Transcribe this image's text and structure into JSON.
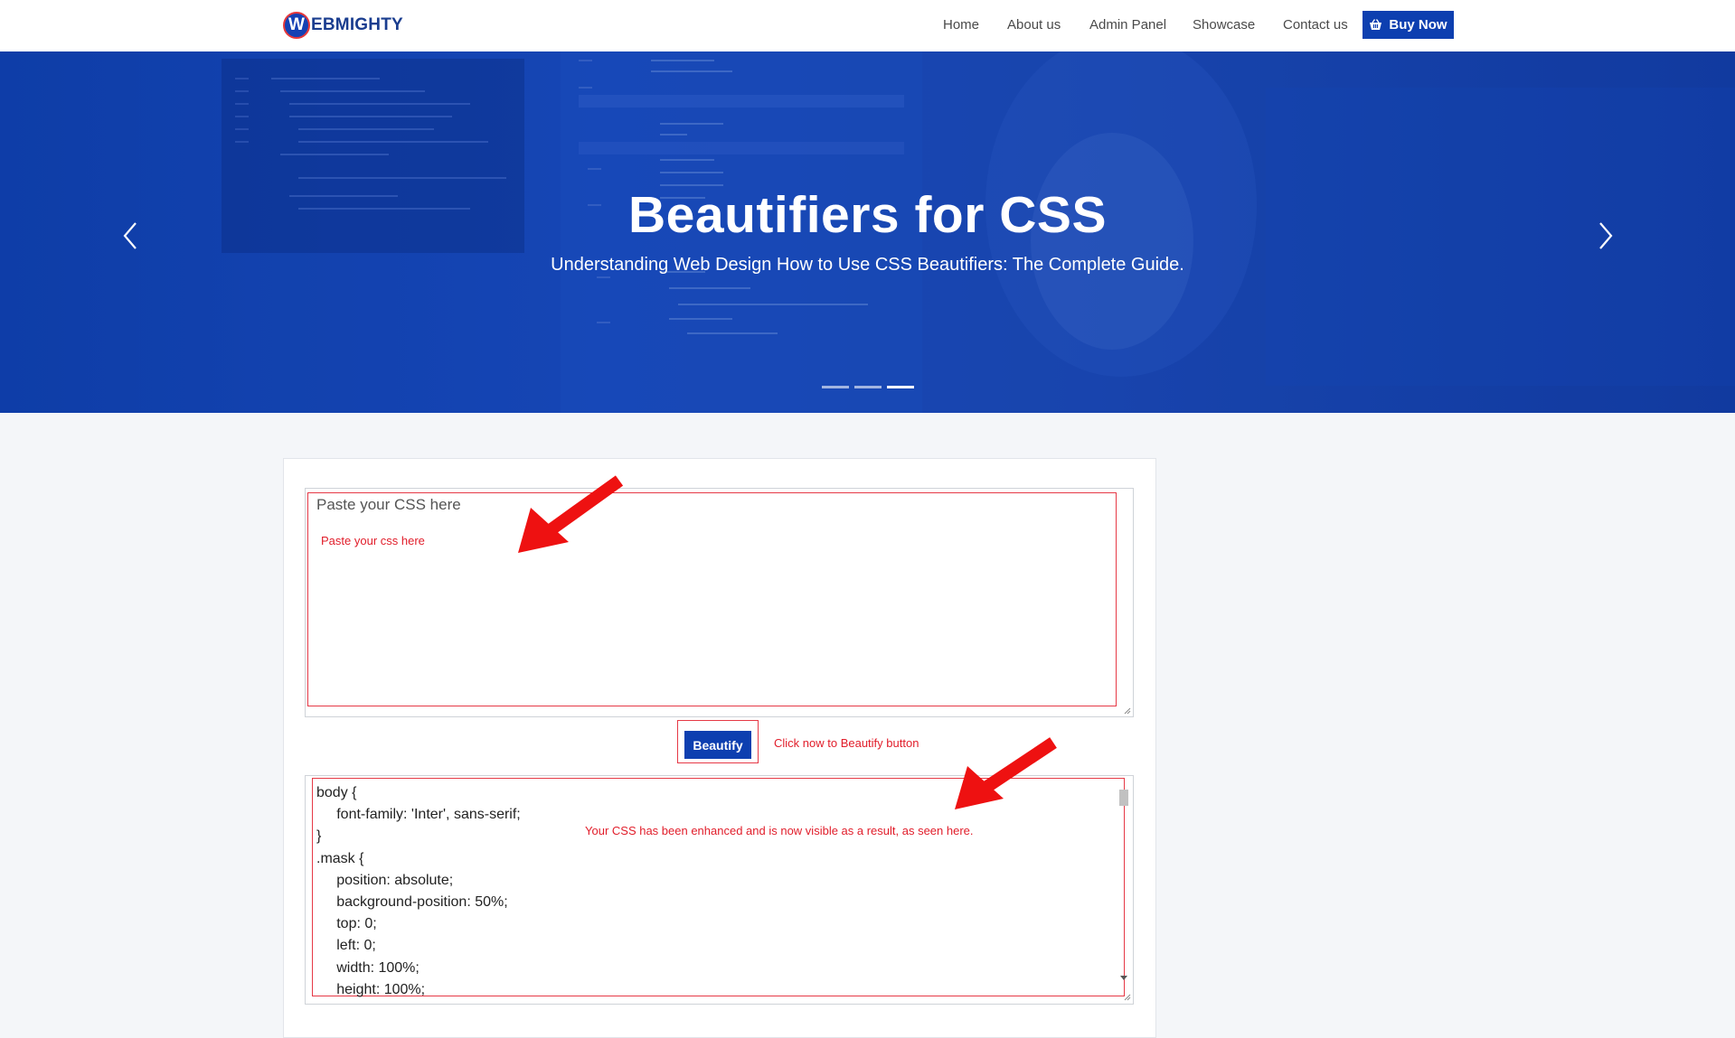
{
  "brand": {
    "logo_letter": "W",
    "logo_text": "EBMIGHTY"
  },
  "nav": {
    "items": [
      "Home",
      "About us",
      "Admin Panel",
      "Showcase",
      "Contact us"
    ],
    "buy_label": "Buy Now"
  },
  "hero": {
    "title": "Beautifiers for CSS",
    "subtitle": "Understanding Web Design How to Use CSS Beautifiers: The Complete Guide.",
    "slide_count": 3,
    "active_slide": 3
  },
  "tool": {
    "input_placeholder": "Paste your CSS here",
    "input_annotation": "Paste your css here",
    "beautify_label": "Beautify",
    "button_annotation": "Click now to Beautify  button",
    "output_annotation": "Your CSS has been enhanced and is now visible as a result, as seen here.",
    "output_lines": [
      "body {",
      "\tfont-family: 'Inter', sans-serif;",
      "}",
      ".mask {",
      "\tposition: absolute;",
      "\tbackground-position: 50%;",
      "\ttop: 0;",
      "\tleft: 0;",
      "\twidth: 100%;",
      "\theight: 100%;"
    ]
  },
  "colors": {
    "brand_blue": "#0d3fb0",
    "annotation_red": "#e11d2a",
    "hero_blue": "#1848b8"
  }
}
